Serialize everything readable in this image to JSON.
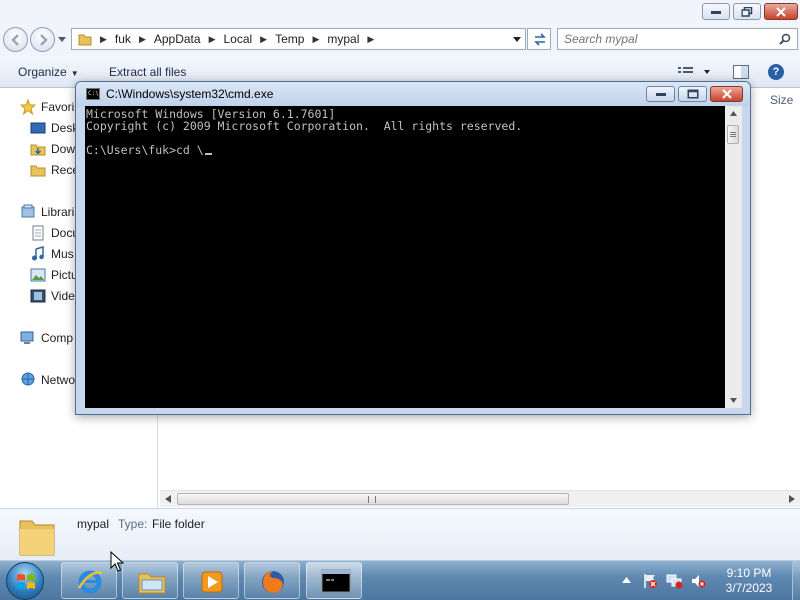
{
  "explorer": {
    "address": {
      "crumbs": [
        "fuk",
        "AppData",
        "Local",
        "Temp",
        "mypal"
      ]
    },
    "search": {
      "placeholder": "Search mypal"
    },
    "toolbar": {
      "organize": "Organize",
      "extract_all": "Extract all files"
    },
    "nav": {
      "favorites": "Favori",
      "desktop": "Desk",
      "downloads": "Dow",
      "recent": "Rece",
      "libraries": "Librari",
      "documents": "Docu",
      "music": "Mus",
      "pictures": "Pictu",
      "videos": "Vide",
      "computer": "Comp",
      "network": "Netwo"
    },
    "column_header": "Size",
    "details": {
      "name": "mypal",
      "type_label": "Type:",
      "type_value": "File folder"
    }
  },
  "cmd": {
    "title": "C:\\Windows\\system32\\cmd.exe",
    "lines": [
      "Microsoft Windows [Version 6.1.7601]",
      "Copyright (c) 2009 Microsoft Corporation.  All rights reserved.",
      "",
      "C:\\Users\\fuk>cd \\"
    ]
  },
  "taskbar": {
    "clock_time": "9:10 PM",
    "clock_date": "3/7/2023",
    "pinned": [
      "internet-explorer",
      "windows-explorer",
      "media-player",
      "firefox",
      "command-prompt"
    ]
  },
  "colors": {
    "console_bg": "#000000",
    "console_fg": "#c0c0c0",
    "taskbar": "#5f89b1",
    "close_button": "#c7422b"
  }
}
